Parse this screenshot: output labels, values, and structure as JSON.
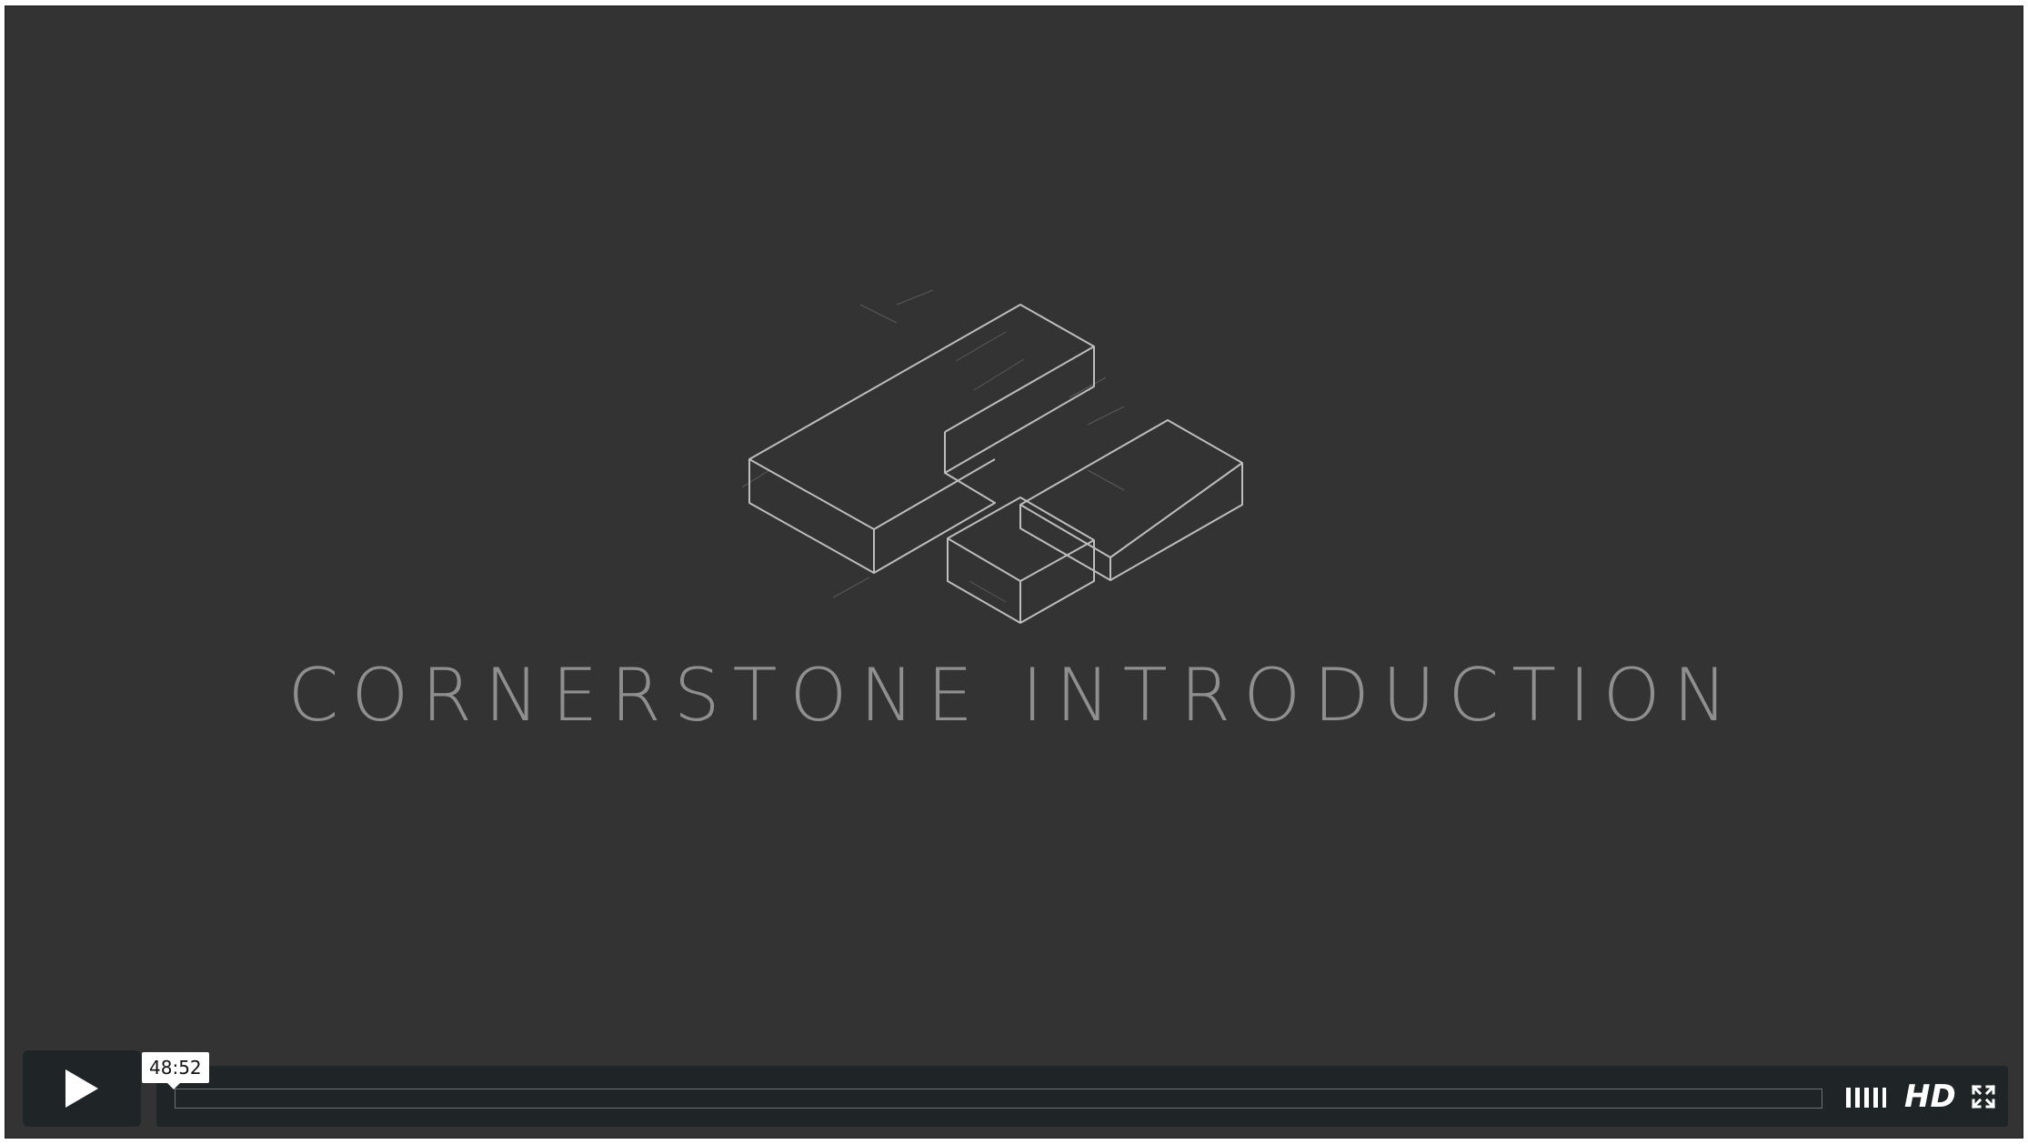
{
  "video": {
    "title": "CORNERSTONE INTRODUCTION"
  },
  "controls": {
    "duration": "48:52",
    "progress": 0,
    "hd_label": "HD"
  },
  "icons": {
    "play": "play-icon",
    "volume": "volume-bars-icon",
    "fullscreen": "fullscreen-icon",
    "logo": "cornerstone-logo"
  },
  "colors": {
    "background": "#333333",
    "controls": "#1f2526",
    "title_text": "#8f8f8f",
    "logo_stroke": "#bdbdbd"
  }
}
